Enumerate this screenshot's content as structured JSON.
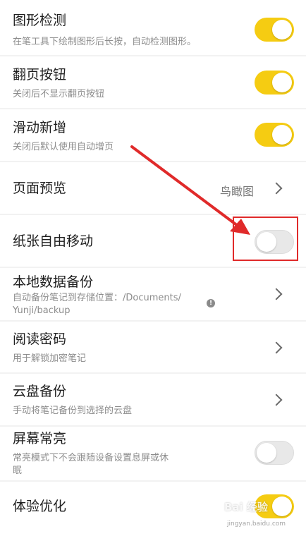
{
  "settings": [
    {
      "title": "图形检测",
      "subtitle": "在笔工具下绘制图形后长按，自动检测图形。",
      "control": "toggle",
      "on": true
    },
    {
      "title": "翻页按钮",
      "subtitle": "关闭后不显示翻页按钮",
      "control": "toggle",
      "on": true
    },
    {
      "title": "滑动新增",
      "subtitle": "关闭后默认使用自动增页",
      "control": "toggle",
      "on": true
    },
    {
      "title": "页面预览",
      "value": "鸟瞰图",
      "control": "chevron"
    },
    {
      "title": "纸张自由移动",
      "control": "toggle",
      "on": false
    },
    {
      "title": "本地数据备份",
      "subtitle": "自动备份笔记到存储位置：/Documents/Yunji/backup",
      "subtitle_line1": "自动备份笔记到存储位置：/Documents/",
      "subtitle_line2": "Yunji/backup",
      "info_icon": "info-icon",
      "control": "chevron"
    },
    {
      "title": "阅读密码",
      "subtitle": "用于解锁加密笔记",
      "control": "chevron"
    },
    {
      "title": "云盘备份",
      "subtitle": "手动将笔记备份到选择的云盘",
      "control": "chevron"
    },
    {
      "title": "屏幕常亮",
      "subtitle": "常亮模式下不会跟随设备设置息屏或休眠",
      "subtitle_line1": "常亮模式下不会跟随设备设置息屏或休",
      "subtitle_line2": "眠",
      "control": "toggle",
      "on": false
    },
    {
      "title": "体验优化",
      "control": "toggle",
      "on": true
    }
  ],
  "watermark": {
    "text": "Bai 经验",
    "sub": "jingyan.baidu.com"
  },
  "colors": {
    "toggle_on": "#f5cc12",
    "toggle_off": "#e8e8e8",
    "annotation": "#e02a2a"
  }
}
